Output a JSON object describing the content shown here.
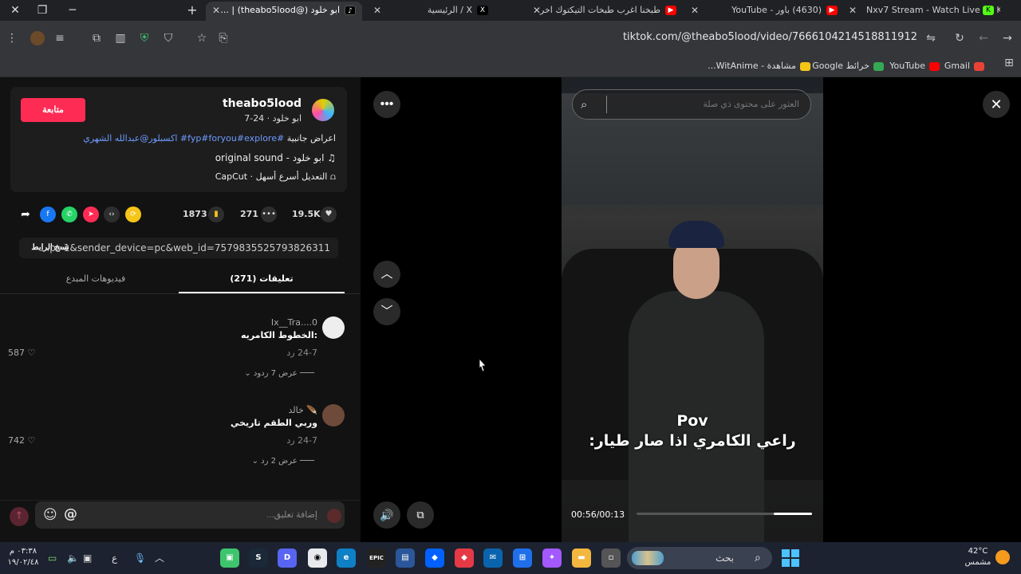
{
  "browser": {
    "window_controls": {
      "close": "✕",
      "restore": "❐",
      "minimize": "─"
    },
    "new_tab": "+",
    "tabs": [
      {
        "title": "ابو خلود (@theabo5lood) | ...",
        "icon": "tiktok-icon",
        "active": true
      },
      {
        "title": "X / الرئيسية",
        "icon": "x-icon",
        "active": false
      },
      {
        "title": "طبخنا اغرب طبخات التيكتوك اخر",
        "icon": "youtube-icon",
        "active": false
      },
      {
        "title": "(4630) باور - YouTube",
        "icon": "youtube-icon",
        "active": false
      },
      {
        "title": "Nxv7 Stream - Watch Live on K",
        "icon": "kick-icon",
        "active": false
      }
    ],
    "url": "tiktok.com/@theabo5lood/video/7666104214518811912",
    "bookmarks": [
      {
        "label": "Gmail",
        "icon": "gmail-icon",
        "color": "#ea4335"
      },
      {
        "label": "YouTube",
        "icon": "youtube-icon",
        "color": "#ff0000"
      },
      {
        "label": "خرائط Google",
        "icon": "maps-icon",
        "color": "#34a853"
      },
      {
        "label": "مشاهدة - WitAnime...",
        "icon": "witanime-icon",
        "color": "#f5c518"
      }
    ]
  },
  "post": {
    "username": "theabo5lood",
    "display_name_date": "ابو خلود · 24-7",
    "follow_label": "متابعة",
    "caption_text": "اعراض جانبية",
    "caption_tags": "#fyp#foryou#explore# اكسبلور@عبدالله الشهري",
    "sound": "original sound - ابو خلود",
    "effect": "CapCut · التعديل أسرع أسهل",
    "likes": "19.5K",
    "comments": "271",
    "saves": "1873",
    "link": "...p=1&sender_device=pc&web_id=7579835525793826311",
    "copy_link_label": "نسخ الرابط"
  },
  "comment_tabs": {
    "comments": "تعليقات (271)",
    "creator_videos": "فيديوهات المبدع"
  },
  "comments": [
    {
      "user": "Ix__Tra....0",
      "text": "الخطوط الكامريه:",
      "meta": "24-7   رد",
      "likes": "587",
      "replies": "عرض 7 ردود"
    },
    {
      "user": "خالد 🪶",
      "text": "وربي الطقم تاريخي",
      "meta": "24-7   رد",
      "likes": "742",
      "replies": "عرض 2 رد"
    }
  ],
  "comment_input": {
    "placeholder": "إضافة تعليق..."
  },
  "video": {
    "search_placeholder": "العثور على محتوى ذي صلة",
    "overlay_title": "Pov",
    "overlay_text": "راعي الكامري اذا صار طيار:",
    "timecode": "00:56/00:13",
    "progress": 0.22
  },
  "taskbar": {
    "time": "٠٣:٣٨ م",
    "date": "١٩/٠٢/٤٨",
    "lang": "ع",
    "search_placeholder": "بحث",
    "temp": "42°C",
    "weather_label": "مشمس"
  }
}
